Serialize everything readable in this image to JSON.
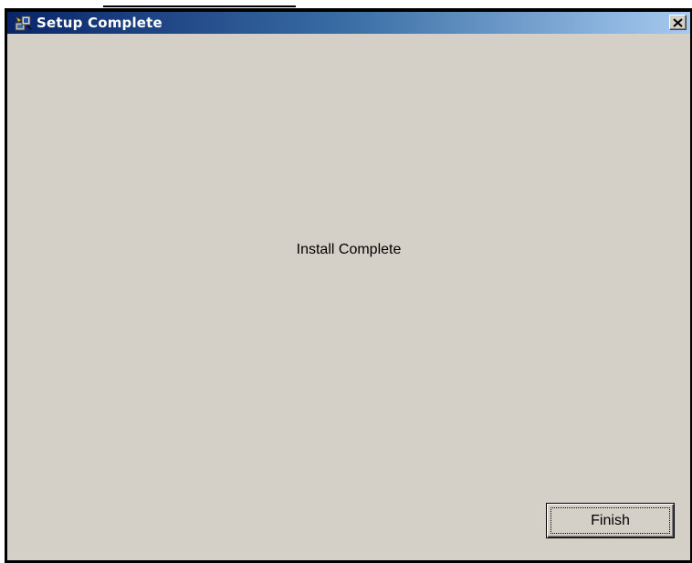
{
  "window": {
    "title": "Setup Complete",
    "app_icon": "setup-installer-icon",
    "close_icon": "close-x-icon"
  },
  "content": {
    "message": "Install Complete"
  },
  "buttons": {
    "finish_label": "Finish"
  },
  "colors": {
    "titlebar_start": "#0a246a",
    "titlebar_end": "#a6caf0",
    "dialog_face": "#d4d0c8",
    "title_text": "#ffffff"
  }
}
